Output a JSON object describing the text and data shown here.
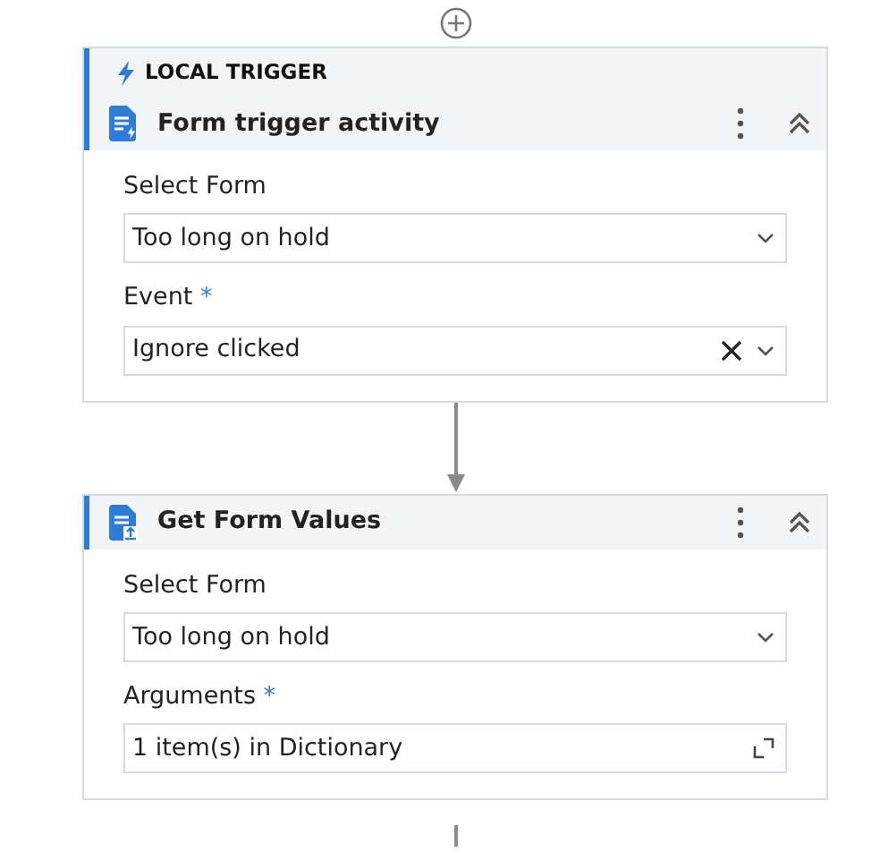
{
  "activities": [
    {
      "kind": "trigger",
      "trigger_label": "LOCAL TRIGGER",
      "title": "Form trigger activity",
      "expanded": true,
      "fields": [
        {
          "label": "Select Form",
          "kind": "dropdown",
          "value": "Too long on hold"
        },
        {
          "label": "Event",
          "required_mark": "*",
          "kind": "clearable",
          "value": "Ignore clicked"
        }
      ]
    },
    {
      "kind": "step",
      "title": "Get Form Values",
      "expanded": true,
      "fields": [
        {
          "label": "Select Form",
          "kind": "dropdown",
          "value": "Too long on hold"
        },
        {
          "label": "Arguments",
          "required_mark": "*",
          "kind": "expandable",
          "value": "1 item(s) in Dictionary"
        }
      ]
    }
  ]
}
